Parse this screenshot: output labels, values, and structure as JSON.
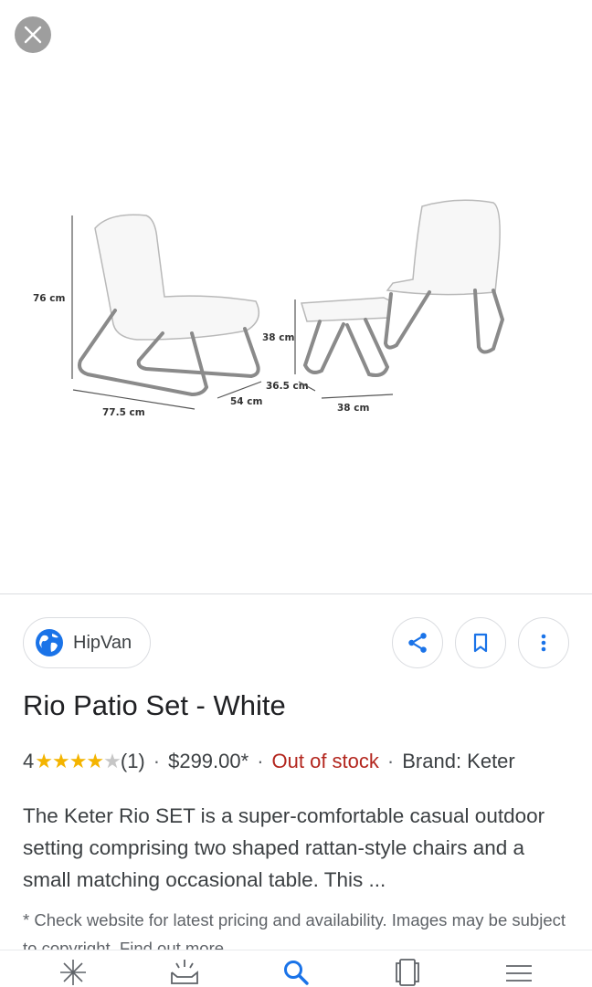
{
  "close_icon": "close-icon",
  "image": {
    "alt_dimensions": [
      "76 cm",
      "77.5 cm",
      "54 cm",
      "38 cm",
      "36.5 cm",
      "38 cm"
    ]
  },
  "source": {
    "label": "HipVan",
    "icon": "globe-icon"
  },
  "actions": {
    "share_icon": "share-icon",
    "bookmark_icon": "bookmark-icon",
    "more_icon": "more-vert-icon"
  },
  "product": {
    "title": "Rio Patio Set - White",
    "rating": "4",
    "stars_filled": "★★★★",
    "stars_empty": "★",
    "review_count": "(1)",
    "price": "$299.00*",
    "stock": "Out of stock",
    "brand": "Brand: Keter",
    "description": "The Keter Rio SET is a super-comfortable casual outdoor setting comprising two shaped rattan-style chairs and a small matching occasional table. This ...",
    "note": "* Check website for latest pricing and availability. Images may be subject to copyright. Find out more"
  },
  "nav": [
    "discover-icon",
    "updates-icon",
    "search-icon",
    "tabs-icon",
    "menu-icon"
  ],
  "colors": {
    "accent": "#1a73e8",
    "star": "#f4b400",
    "out_of_stock": "#b3261e"
  }
}
